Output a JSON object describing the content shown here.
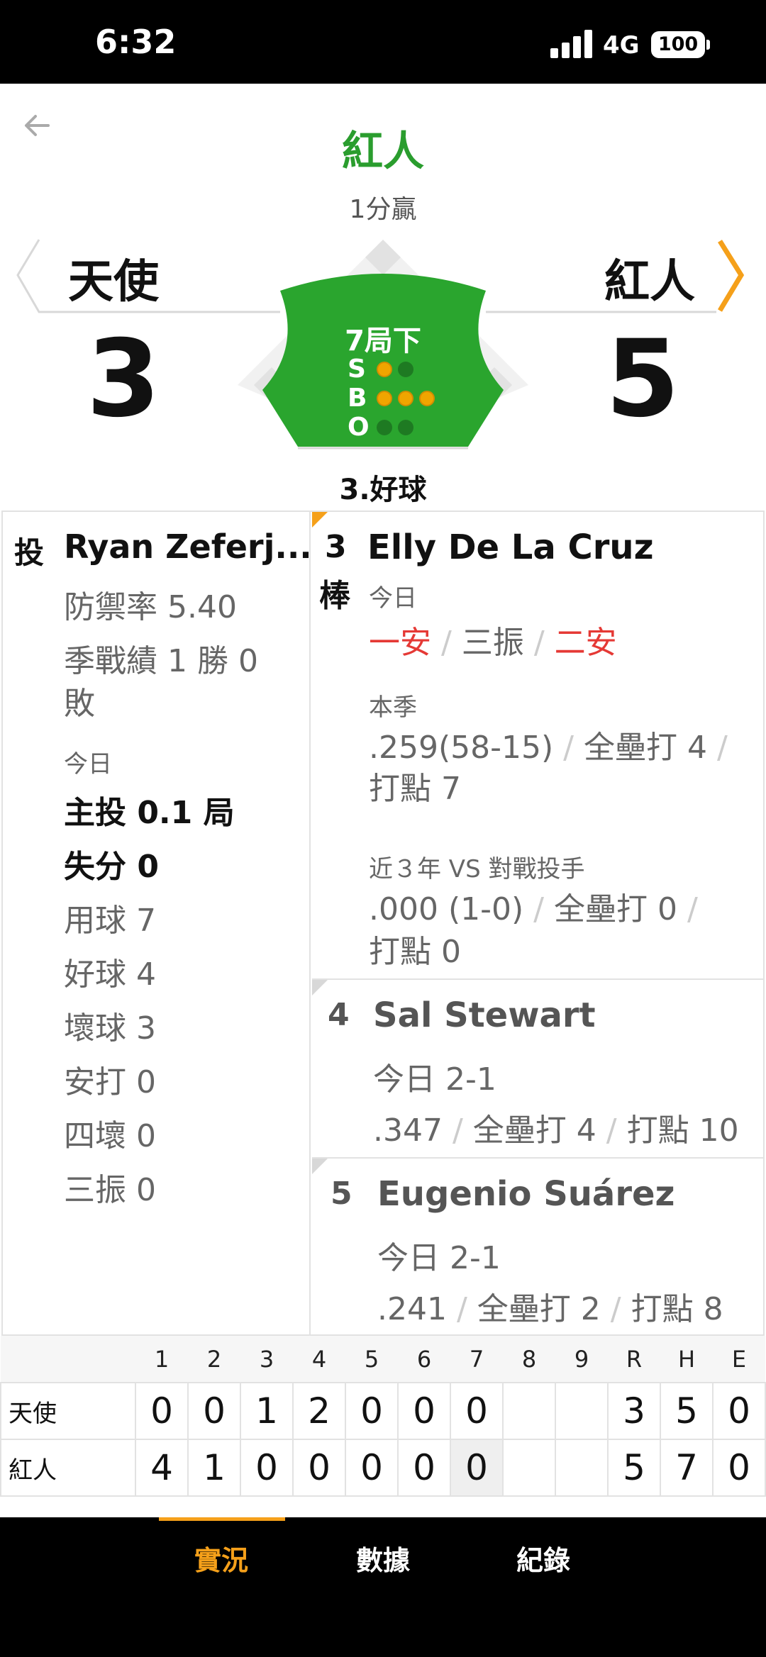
{
  "status_bar": {
    "time": "6:32",
    "network": "4G",
    "battery": "100"
  },
  "header": {
    "title": "紅人",
    "subtitle": "1分贏"
  },
  "away": {
    "name": "天使",
    "score": "3"
  },
  "home": {
    "name": "紅人",
    "score": "5"
  },
  "situation": {
    "inning": "7局下",
    "labels": {
      "s": "S",
      "b": "B",
      "o": "O"
    },
    "strikes": 1,
    "balls": 3,
    "outs": 0,
    "last_pitch": "3.好球"
  },
  "pitcher": {
    "tag": "投",
    "name": "Ryan Zeferj...",
    "era": "防禦率 5.40",
    "record_line1": "季戰績 1 勝 0",
    "record_line2": "敗",
    "today_label": "今日",
    "stats_bold": [
      "主投 0.1 局",
      "失分 0"
    ],
    "stats": [
      "用球 7",
      "好球 4",
      "壞球 3",
      "安打 0",
      "四壞 0",
      "三振 0"
    ]
  },
  "current_batter": {
    "order": "3",
    "tag": "棒",
    "name": "Elly De La Cruz",
    "today_label": "今日",
    "today_results": [
      "一安",
      "三振",
      "二安"
    ],
    "season_label": "本季",
    "season_avg": ".259(58-15)",
    "season_hr": "全壘打 4",
    "season_rbi": "打點 7",
    "vs_label": "近３年 VS 對戰投手",
    "vs_avg": ".000 (1-0)",
    "vs_hr": "全壘打 0",
    "vs_rbi": "打點 0",
    "sep": "/"
  },
  "on_deck": [
    {
      "order": "4",
      "name": "Sal Stewart",
      "today": "今日 2-1",
      "avg": ".347",
      "hr": "全壘打 4",
      "rbi": "打點 10"
    },
    {
      "order": "5",
      "name": "Eugenio Suárez",
      "today": "今日 2-1",
      "avg": ".241",
      "hr": "全壘打 2",
      "rbi": "打點 8"
    }
  ],
  "linescore": {
    "headers": [
      "1",
      "2",
      "3",
      "4",
      "5",
      "6",
      "7",
      "8",
      "9",
      "R",
      "H",
      "E"
    ],
    "rows": [
      {
        "team": "天使",
        "cells": [
          "0",
          "0",
          "1",
          "2",
          "0",
          "0",
          "0",
          "",
          "",
          "3",
          "5",
          "0"
        ]
      },
      {
        "team": "紅人",
        "cells": [
          "4",
          "1",
          "0",
          "0",
          "0",
          "0",
          "0",
          "",
          "",
          "5",
          "7",
          "0"
        ]
      }
    ]
  },
  "nav": {
    "tabs": [
      "實況",
      "數據",
      "紀錄"
    ],
    "active": "實況"
  },
  "colors": {
    "accent": "#f5a01a",
    "field": "#2aa52e",
    "win": "#2a9d2e",
    "hit": "#e53935"
  }
}
